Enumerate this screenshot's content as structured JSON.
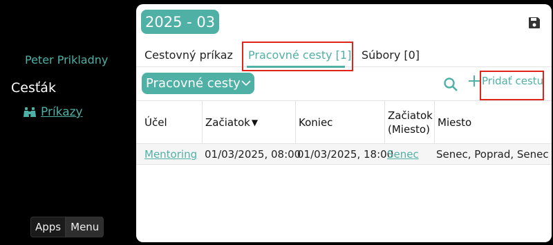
{
  "sidebar": {
    "user_name": "Peter Prikladny",
    "app_name": "Cesťák",
    "nav": {
      "label": "Príkazy",
      "icon": "binoculars-icon"
    },
    "apps_label": "Apps",
    "menu_label": "Menu"
  },
  "header": {
    "period": "2025 - 03",
    "save_icon": "save-icon"
  },
  "tabs": [
    {
      "label": "Cestovný príkaz"
    },
    {
      "label": "Pracovné cesty [1]",
      "active": true
    },
    {
      "label": "Súbory [0]"
    }
  ],
  "toolbar": {
    "filter_value": "Pracovné cesty",
    "add_label": "Pridať cestu"
  },
  "table": {
    "columns": [
      "Účel",
      "Začiatok",
      "Koniec",
      "Začiatok (Miesto)",
      "Miesto"
    ],
    "sort_indicator": "▼",
    "rows": [
      {
        "ucel": "Mentoring",
        "zaciatok": "01/03/2025, 08:00",
        "koniec": "01/03/2025, 18:00",
        "zaciatok_miesto": "Senec",
        "miesto": "Senec, Poprad, Senec"
      }
    ]
  },
  "colors": {
    "accent": "#4fb0a5",
    "highlight_border": "#e02418",
    "background": "#000000"
  }
}
